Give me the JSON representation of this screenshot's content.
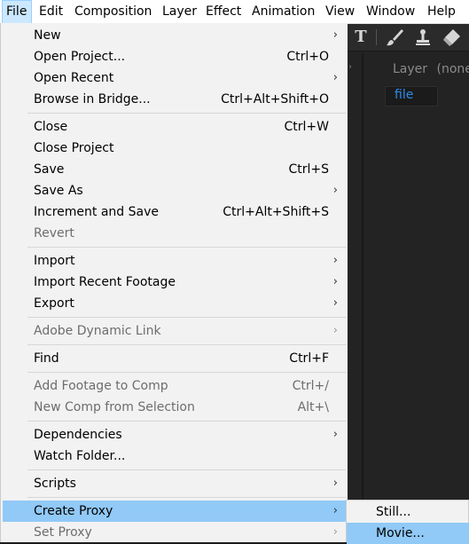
{
  "menubar": {
    "file": "File",
    "edit": "Edit",
    "composition": "Composition",
    "layer": "Layer",
    "effect": "Effect",
    "animation": "Animation",
    "view": "View",
    "window": "Window",
    "help": "Help"
  },
  "toolbar": {
    "tools": [
      "type-tool-icon",
      "brush-tool-icon",
      "clone-stamp-tool-icon",
      "eraser-tool-icon"
    ],
    "type_glyph": "T"
  },
  "layer_panel": {
    "title": "Layer",
    "value": "(none)",
    "tab_label": "file",
    "tab_color": "#2d8ceb"
  },
  "file_menu": {
    "items": [
      {
        "label": "New",
        "shortcut": "",
        "submenu": "›"
      },
      {
        "label": "Open Project...",
        "shortcut": "Ctrl+O"
      },
      {
        "label": "Open Recent",
        "submenu": "›"
      },
      {
        "label": "Browse in Bridge...",
        "shortcut": "Ctrl+Alt+Shift+O"
      },
      {
        "label": "Close",
        "shortcut": "Ctrl+W"
      },
      {
        "label": "Close Project"
      },
      {
        "label": "Save",
        "shortcut": "Ctrl+S"
      },
      {
        "label": "Save As",
        "submenu": "›"
      },
      {
        "label": "Increment and Save",
        "shortcut": "Ctrl+Alt+Shift+S"
      },
      {
        "label": "Revert",
        "disabled": true
      },
      {
        "label": "Import",
        "submenu": "›"
      },
      {
        "label": "Import Recent Footage",
        "submenu": "›"
      },
      {
        "label": "Export",
        "submenu": "›"
      },
      {
        "label": "Adobe Dynamic Link",
        "submenu": "›",
        "disabled": true
      },
      {
        "label": "Find",
        "shortcut": "Ctrl+F"
      },
      {
        "label": "Add Footage to Comp",
        "shortcut": "Ctrl+/",
        "disabled": true
      },
      {
        "label": "New Comp from Selection",
        "shortcut": "Alt+\\",
        "disabled": true
      },
      {
        "label": "Dependencies",
        "submenu": "›"
      },
      {
        "label": "Watch Folder..."
      },
      {
        "label": "Scripts",
        "submenu": "›"
      },
      {
        "label": "Create Proxy",
        "submenu": "›",
        "highlighted": true
      },
      {
        "label": "Set Proxy",
        "submenu": "›",
        "disabled": true
      }
    ]
  },
  "proxy_submenu": {
    "items": [
      {
        "label": "Still..."
      },
      {
        "label": "Movie...",
        "highlighted": true
      }
    ]
  },
  "colors": {
    "menu_bg": "#f2f2f2",
    "highlight": "#91c9f7",
    "menubar_active": "#cce8ff",
    "disabled_text": "#6d6d6d"
  }
}
